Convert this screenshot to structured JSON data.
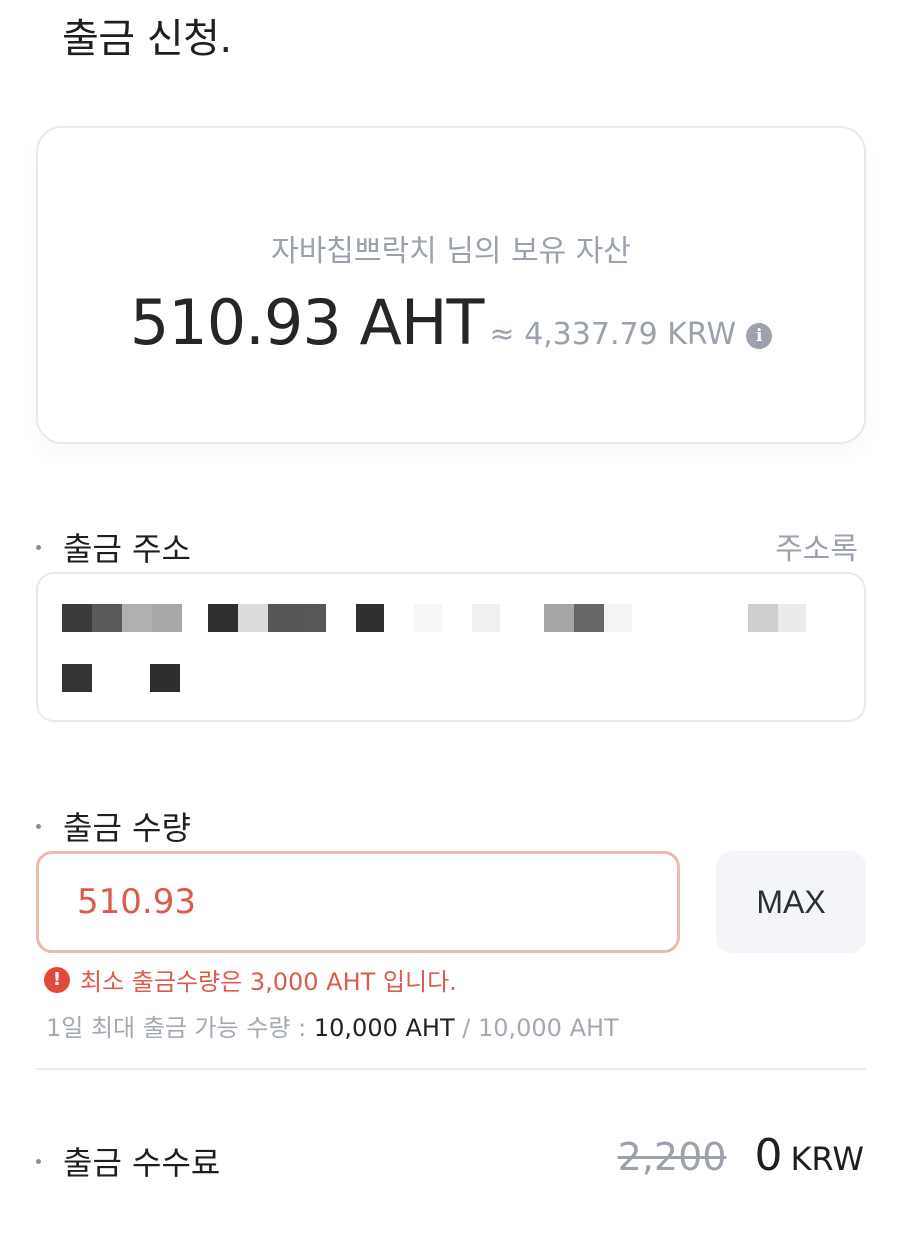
{
  "page": {
    "title": "출금 신청."
  },
  "balance": {
    "owner_text": "자바칩쁘락치 님의 보유 자산",
    "amount": "510.93 AHT",
    "approx": "≈ 4,337.79 KRW"
  },
  "address": {
    "label": "출금 주소",
    "book_link": "주소록"
  },
  "amount": {
    "label": "출금 수량",
    "value": "510.93",
    "max_label": "MAX",
    "error": "최소 출금수량은 3,000 AHT 입니다.",
    "limit_label": "1일 최대 출금 가능 수량 :",
    "limit_value": "10,000 AHT",
    "limit_total": "/ 10,000 AHT"
  },
  "fee": {
    "label": "출금 수수료",
    "original": "2,200",
    "value": "0",
    "unit": "KRW"
  },
  "colors": {
    "error": "#dd5b4a",
    "muted": "#9ba2ad",
    "border": "#e6eaf0"
  },
  "icons": {
    "info": "info-icon",
    "error": "error-icon"
  }
}
